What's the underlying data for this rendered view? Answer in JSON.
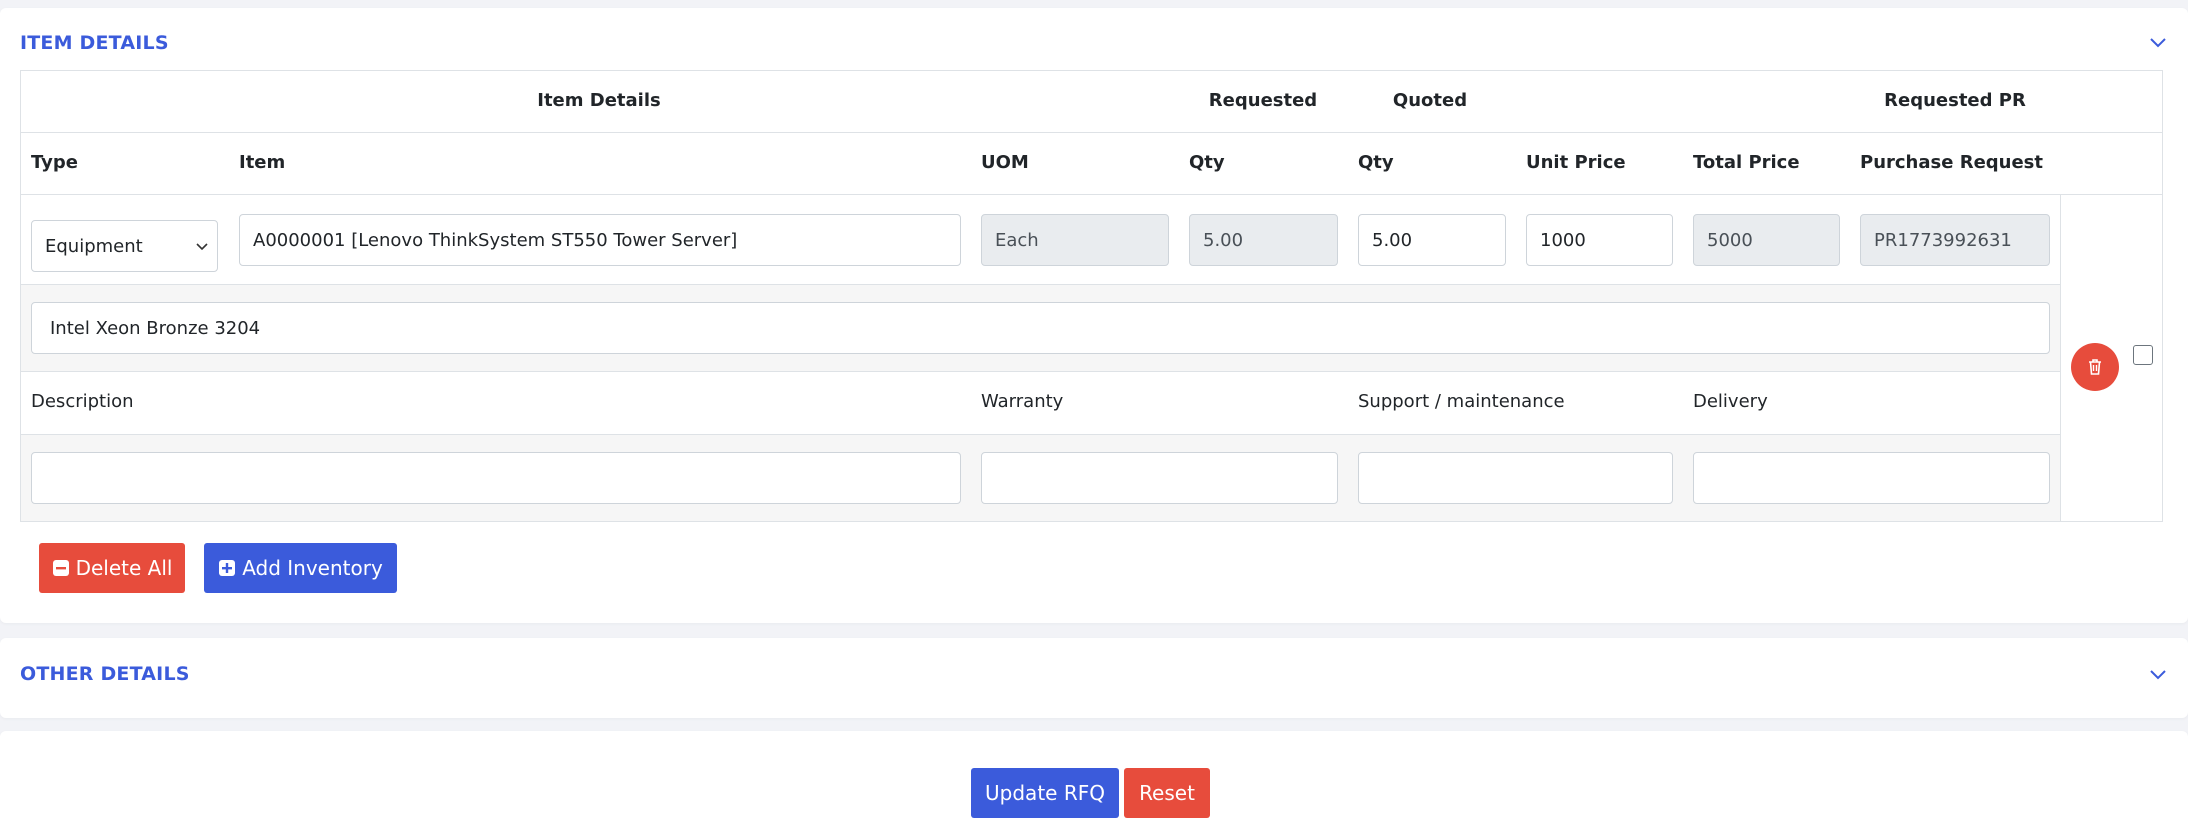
{
  "item_section": {
    "title": "ITEM DETAILS",
    "group_headers": {
      "item_details": "Item Details",
      "requested": "Requested",
      "quoted": "Quoted",
      "requested_pr": "Requested PR"
    },
    "columns": {
      "type": "Type",
      "item": "Item",
      "uom": "UOM",
      "req_qty": "Qty",
      "quoted_qty": "Qty",
      "unit_price": "Unit Price",
      "total_price": "Total Price",
      "purchase_request": "Purchase Request"
    },
    "row": {
      "type": "Equipment",
      "item": "A0000001 [Lenovo ThinkSystem ST550 Tower Server]",
      "uom": "Each",
      "req_qty": "5.00",
      "quoted_qty": "5.00",
      "unit_price": "1000",
      "total_price": "5000",
      "purchase_request": "PR1773992631",
      "spec": "Intel Xeon Bronze 3204",
      "description": "",
      "warranty": "",
      "support": "",
      "delivery": ""
    },
    "sub_labels": {
      "description": "Description",
      "warranty": "Warranty",
      "support": "Support / maintenance",
      "delivery": "Delivery"
    },
    "buttons": {
      "delete_all": "Delete All",
      "add_inventory": "Add Inventory"
    }
  },
  "other_section": {
    "title": "OTHER DETAILS"
  },
  "footer": {
    "update_label": "Update RFQ",
    "reset_label": "Reset"
  },
  "colors": {
    "accent_blue": "#3b5bdb",
    "danger_red": "#e74c3c"
  },
  "icons": [
    "chevron-down-icon",
    "trash-icon",
    "minus-square-icon",
    "plus-square-icon"
  ]
}
